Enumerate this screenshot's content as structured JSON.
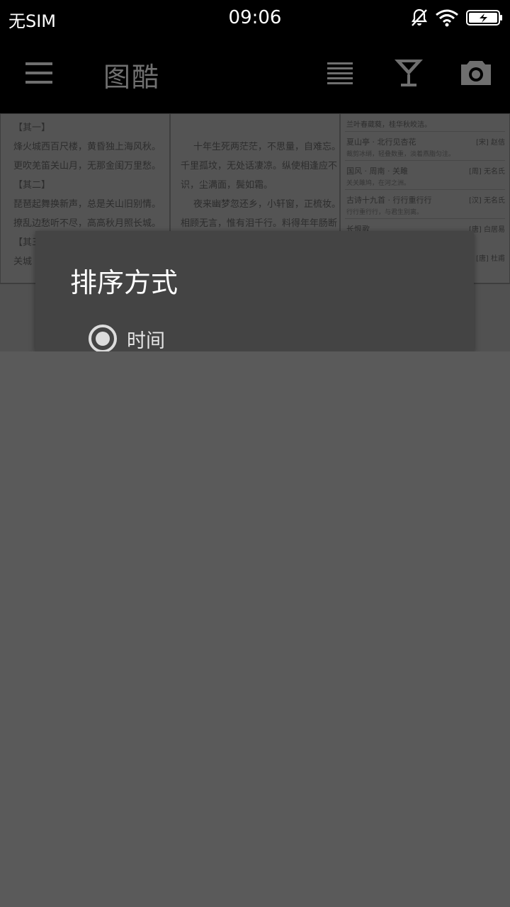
{
  "status_bar": {
    "carrier": "无SIM",
    "time": "09:06",
    "icons": [
      "bell-muted-icon",
      "wifi-icon",
      "battery-charging-icon"
    ]
  },
  "app_bar": {
    "title": "图酷",
    "actions": [
      "menu-icon",
      "list-icon",
      "cocktail-icon",
      "camera-icon"
    ]
  },
  "grid": {
    "thumb1_lines": [
      "【其一】",
      "烽火城西百尺楼，黄昏独上海风秋。",
      "更吹羌笛关山月，无那金闺万里愁。",
      "【其二】",
      "琵琶起舞换新声，总是关山旧别情。",
      "撩乱边愁听不尽，高高秋月照长城。",
      "【其三】",
      "关城"
    ],
    "thumb2_lines": [
      "十年生死两茫茫，不思量，自难忘。",
      "千里孤坟，无处话凄凉。纵使相逢应不",
      "识，尘满面，鬓如霜。",
      "夜来幽梦忽还乡，小轩窗，正梳妆。",
      "相顾无言，惟有泪千行。料得年年肠断"
    ],
    "thumb3_rows": [
      {
        "title": "兰叶春葳蕤，桂华秋皎洁。",
        "author": "",
        "sub": ""
      },
      {
        "title": "夏山亭 · 北行见杏花",
        "author": "[宋] 赵佶",
        "sub": "裁剪冰绡，轻叠数重，淡着燕脂匀注。"
      },
      {
        "title": "国风 · 周南 · 关雎",
        "author": "[周] 无名氏",
        "sub": "关关雎鸠，在河之洲。"
      },
      {
        "title": "古诗十九首 · 行行重行行",
        "author": "[汉] 无名氏",
        "sub": "行行重行行，与君生别离。"
      },
      {
        "title": "长恨歌",
        "author": "[唐] 白居易",
        "sub": ""
      },
      {
        "title": "",
        "author": "[唐] 杜甫",
        "sub": ""
      }
    ]
  },
  "dialog": {
    "title": "排序方式",
    "options": [
      {
        "label": "时间",
        "selected": true
      }
    ]
  }
}
